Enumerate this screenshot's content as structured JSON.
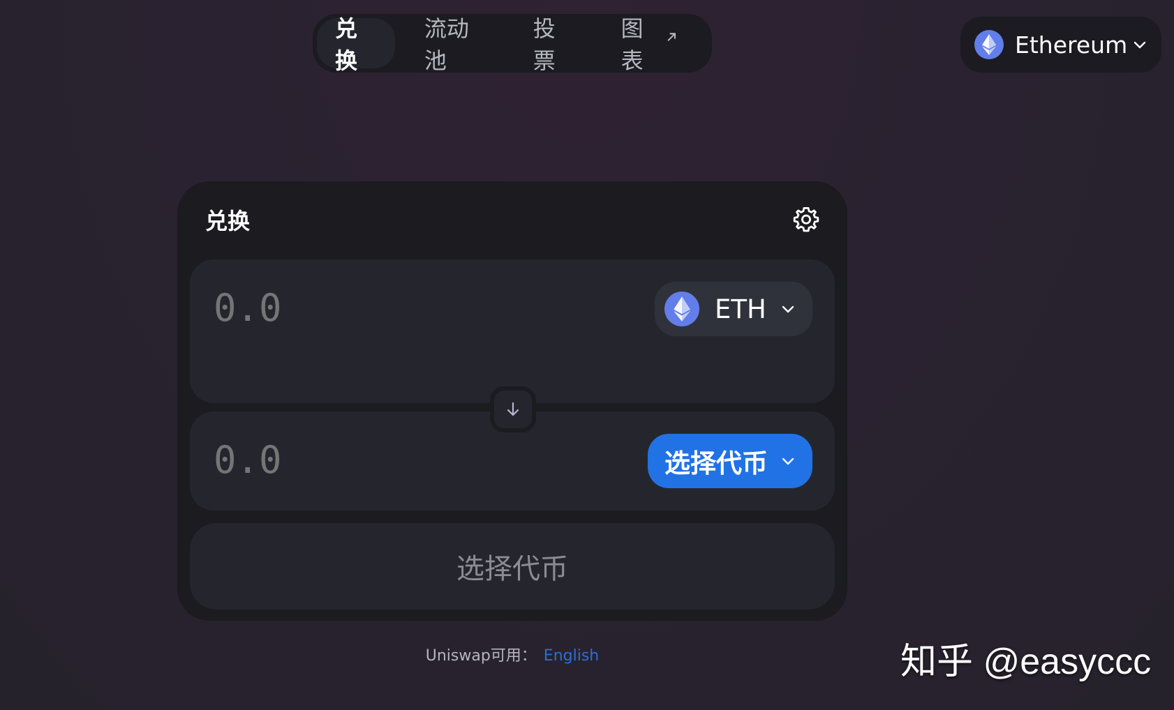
{
  "nav": {
    "tabs": [
      {
        "label": "兑换",
        "active": true
      },
      {
        "label": "流动池",
        "active": false
      },
      {
        "label": "投票",
        "active": false
      },
      {
        "label": "图表",
        "active": false,
        "external": true
      }
    ]
  },
  "network": {
    "label": "Ethereum",
    "icon": "ethereum-icon"
  },
  "swap": {
    "title": "兑换",
    "settings_icon": "gear-icon",
    "from": {
      "amount": "0.0",
      "token": "ETH"
    },
    "to": {
      "amount": "0.0",
      "token_button": "选择代币"
    },
    "submit_label": "选择代币"
  },
  "footer": {
    "text": "Uniswap可用：",
    "language": "English"
  },
  "watermark": "知乎 @easyccc",
  "colors": {
    "background": "#2a2230",
    "card": "#1b1b20",
    "panel": "#25262d",
    "accent_blue": "#2172e5",
    "eth_purple": "#627eea",
    "link": "#2b6ed6"
  }
}
